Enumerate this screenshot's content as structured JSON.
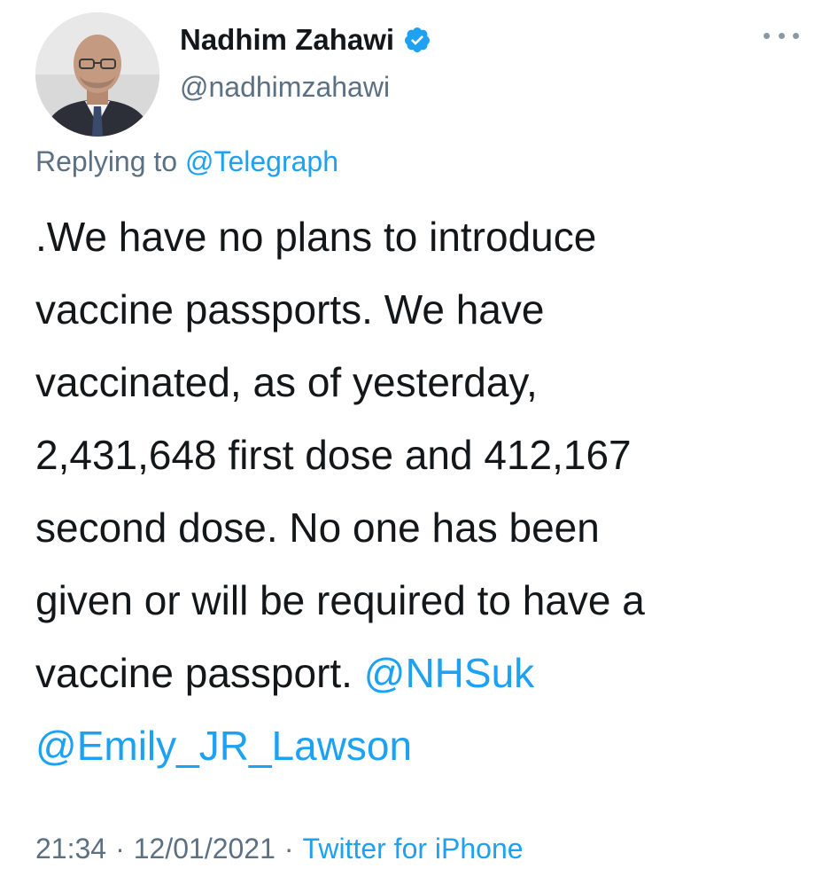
{
  "author": {
    "display_name": "Nadhim Zahawi",
    "handle": "@nadhimzahawi",
    "verified_icon": "verified-badge-icon",
    "avatar": "profile-photo"
  },
  "more_menu": {
    "icon": "more-options-icon"
  },
  "reply": {
    "prefix": "Replying to",
    "target": "@Telegraph"
  },
  "tweet": {
    "lines": [
      ".We have no plans to introduce",
      "vaccine passports. We have",
      "vaccinated, as of yesterday,",
      "2,431,648 first dose and 412,167",
      "second dose. No one has been",
      "given or will be required to have a",
      "vaccine passport."
    ],
    "mentions": [
      "@NHSuk",
      "@Emily_JR_Lawson"
    ]
  },
  "meta": {
    "time": "21:34",
    "date": "12/01/2021",
    "separator": "·",
    "source": "Twitter for iPhone"
  },
  "colors": {
    "link": "#1da1f2",
    "text": "#14171a",
    "secondary": "#5b7083"
  }
}
